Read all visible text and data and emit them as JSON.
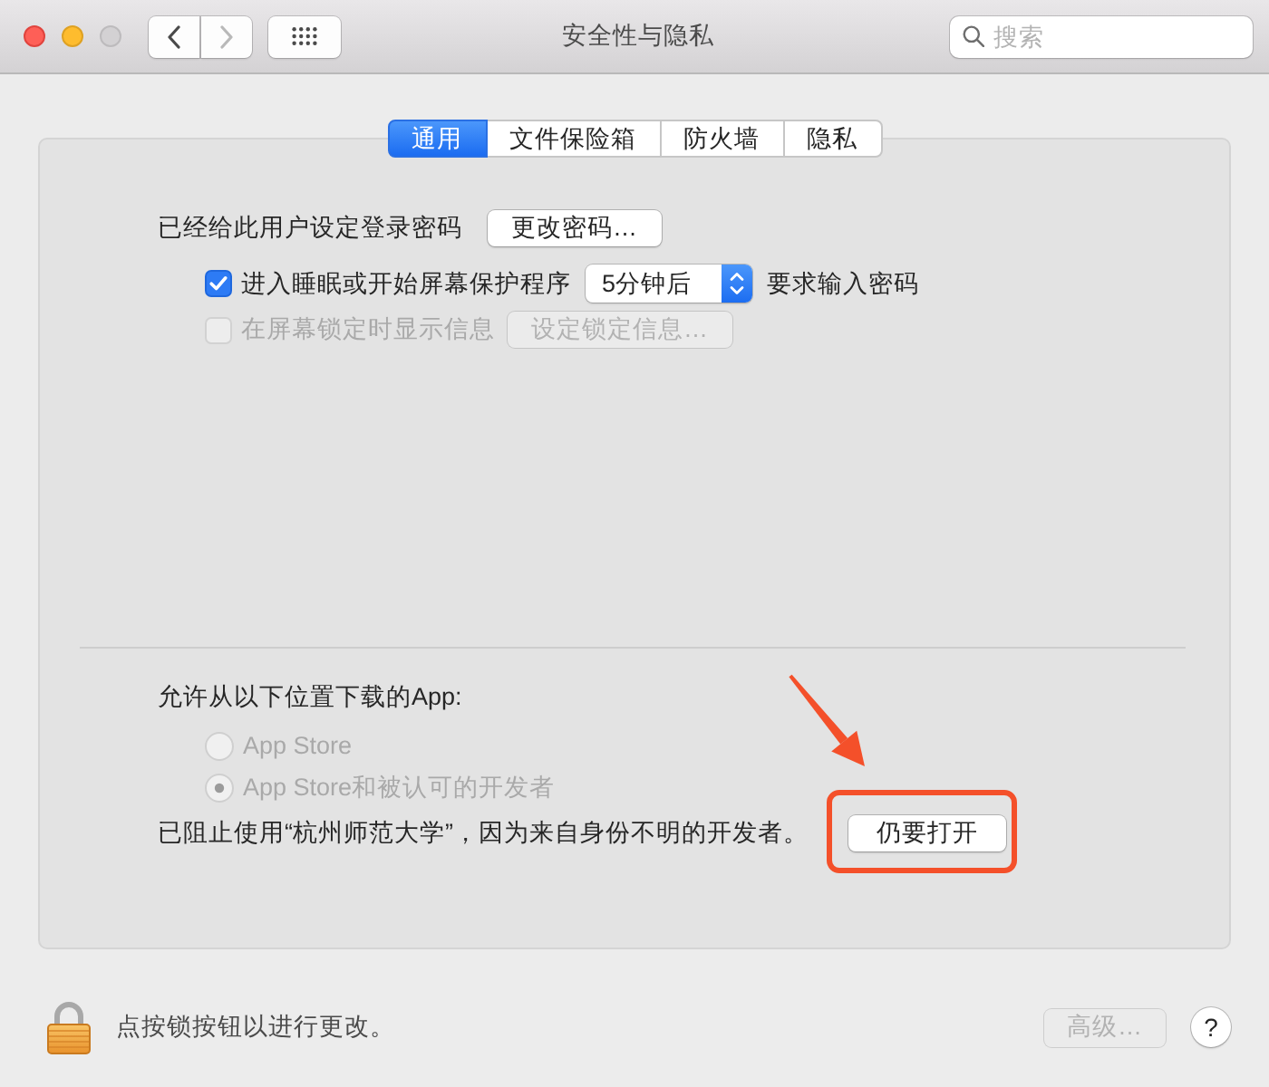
{
  "window": {
    "title": "安全性与隐私"
  },
  "toolbar": {
    "back": {
      "disabled": false
    },
    "forward": {
      "disabled": true
    },
    "search": {
      "placeholder": "搜索"
    }
  },
  "tabs": [
    {
      "label": "通用",
      "selected": true
    },
    {
      "label": "文件保险箱",
      "selected": false
    },
    {
      "label": "防火墙",
      "selected": false
    },
    {
      "label": "隐私",
      "selected": false
    }
  ],
  "general": {
    "password": {
      "label": "已经给此用户设定登录密码",
      "button": "更改密码…"
    },
    "require_password": {
      "checked": true,
      "label": "进入睡眠或开始屏幕保护程序",
      "delay": "5分钟后",
      "suffix": "要求输入密码"
    },
    "lock_message": {
      "checked": false,
      "disabled": true,
      "label": "在屏幕锁定时显示信息",
      "button": "设定锁定信息…"
    },
    "downloads": {
      "heading": "允许从以下位置下载的App:",
      "disabled": true,
      "options": [
        {
          "label": "App Store",
          "selected": false
        },
        {
          "label": "App Store和被认可的开发者",
          "selected": true
        }
      ]
    },
    "blocked": {
      "message": "已阻止使用“杭州师范大学”，因为来自身份不明的开发者。",
      "button": "仍要打开",
      "highlighted": true
    }
  },
  "footer": {
    "lock_hint": "点按锁按钮以进行更改。",
    "advanced_button": {
      "label": "高级…",
      "disabled": true
    },
    "help": "?"
  }
}
